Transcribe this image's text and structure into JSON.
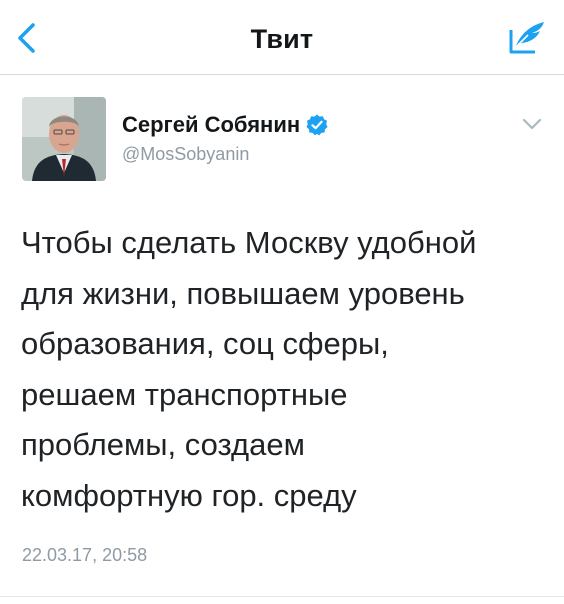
{
  "nav": {
    "back_icon": "chevron-left-icon",
    "title": "Твит",
    "compose_icon": "compose-tweet-icon"
  },
  "author": {
    "name": "Сергей Собянин",
    "handle": "@MosSobyanin",
    "verified": true,
    "avatar_icon": "avatar-photo"
  },
  "menu_icon": "chevron-down-icon",
  "tweet": {
    "lines": [
      "Чтобы сделать Москву удобной",
      "для жизни, повышаем уровень",
      "образования, соц сферы,",
      "решаем транспортные",
      "проблемы, создаем",
      "комфортную гор. среду"
    ],
    "timestamp": "22.03.17, 20:58"
  },
  "colors": {
    "accent": "#1da1f2",
    "text": "#14171a",
    "secondary_text": "#8f9aa3",
    "divider": "#d8d8d8"
  }
}
